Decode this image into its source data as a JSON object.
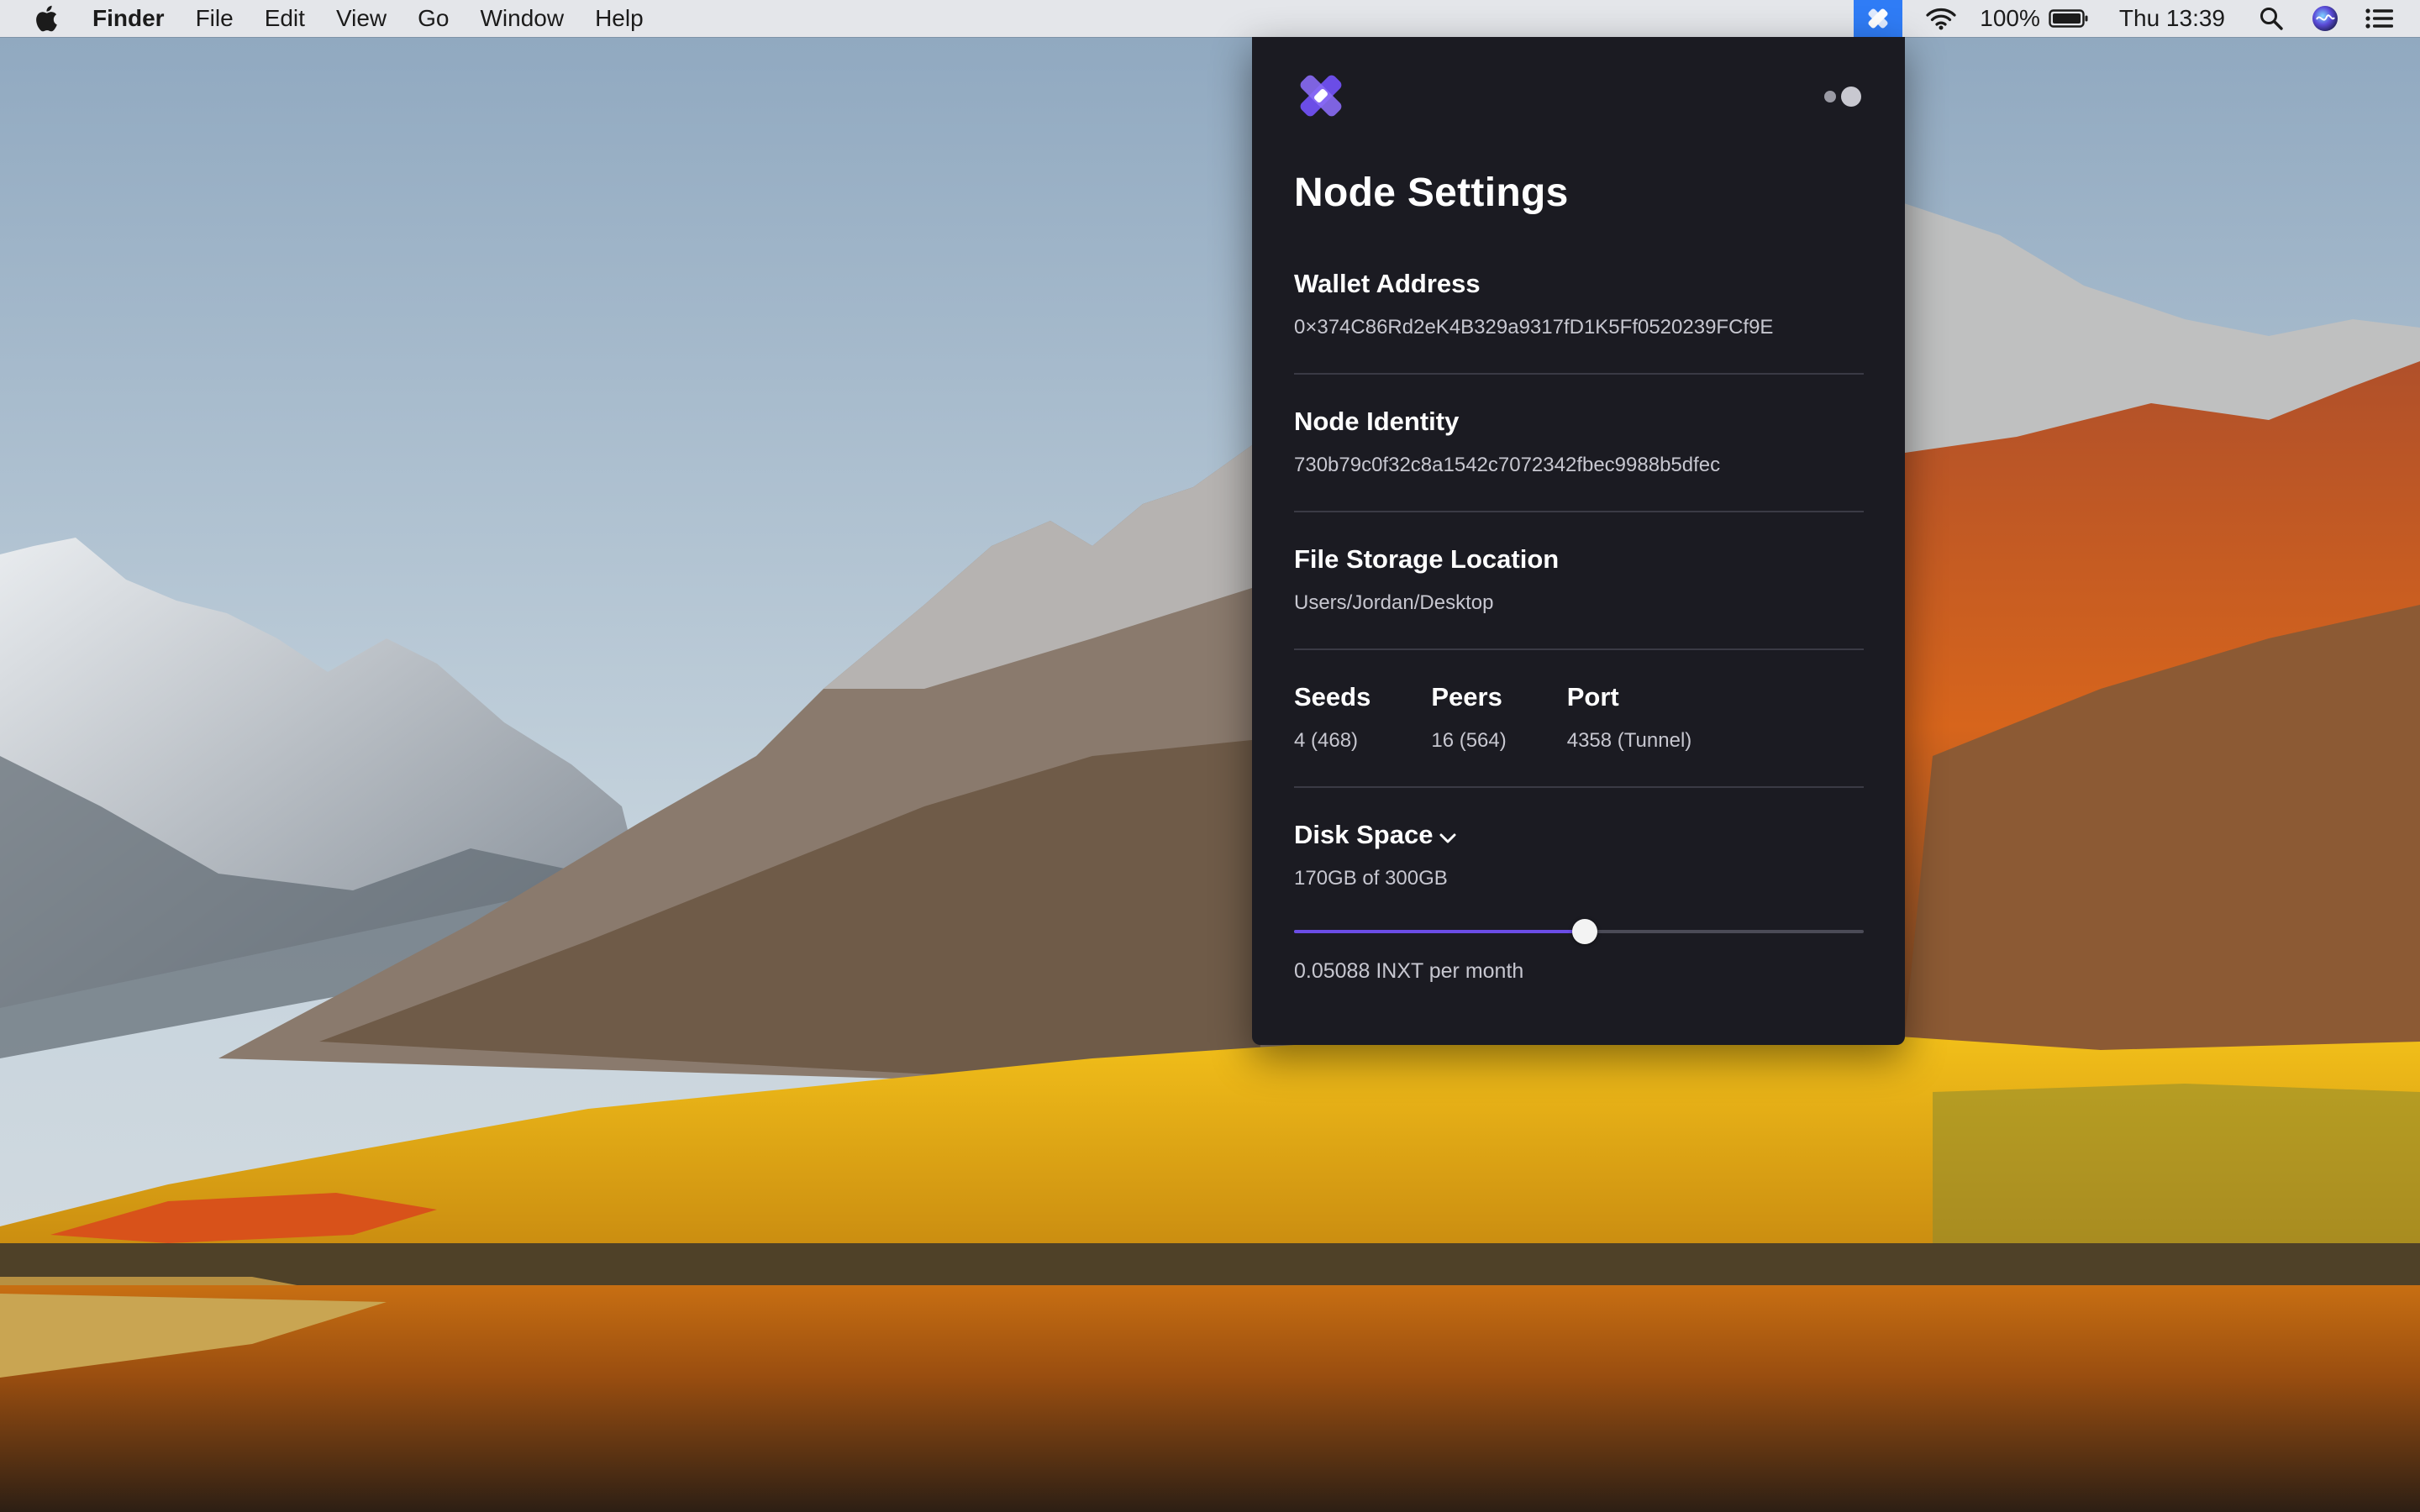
{
  "menubar": {
    "app_name": "Finder",
    "menus": [
      "File",
      "Edit",
      "View",
      "Go",
      "Window",
      "Help"
    ],
    "battery": "100%",
    "clock": "Thu 13:39",
    "icons": [
      "apple-icon",
      "internxt-tray-icon",
      "wifi-icon",
      "battery-icon",
      "search-icon",
      "siri-icon",
      "notification-list-icon"
    ]
  },
  "panel": {
    "title": "Node Settings",
    "wallet": {
      "label": "Wallet Address",
      "value": "0×374C86Rd2eK4B329a9317fD1K5Ff0520239FCf9E"
    },
    "identity": {
      "label": "Node Identity",
      "value": "730b79c0f32c8a1542c7072342fbec9988b5dfec"
    },
    "storage": {
      "label": "File Storage Location",
      "value": "Users/Jordan/Desktop"
    },
    "stats": [
      {
        "label": "Seeds",
        "value": "4 (468)"
      },
      {
        "label": "Peers",
        "value": "16 (564)"
      },
      {
        "label": "Port",
        "value": "4358 (Tunnel)"
      }
    ],
    "disk": {
      "label": "Disk Space",
      "value": "170GB of 300GB",
      "fill_fraction": 0.51,
      "price": "0.05088 INXT per month"
    }
  },
  "colors": {
    "panel_bg": "#1b1b22",
    "accent": "#6b4de6",
    "tray_highlight": "#2f7cf6"
  }
}
